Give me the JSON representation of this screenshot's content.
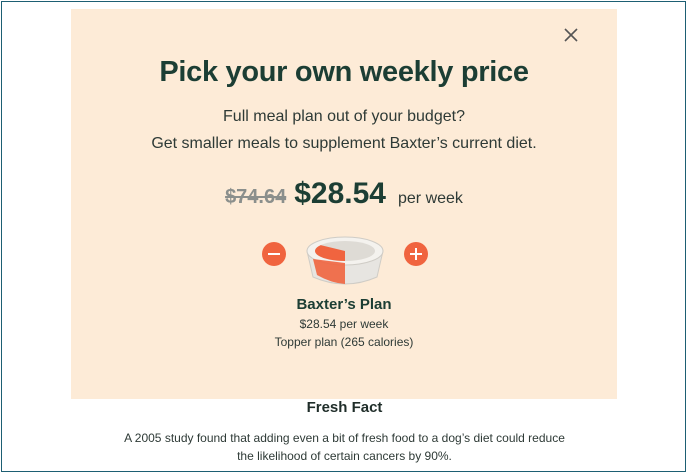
{
  "modal": {
    "title": "Pick your own weekly price",
    "subtitle_line1": "Full meal plan out of your budget?",
    "subtitle_line2": "Get smaller meals to supplement Baxter’s current diet.",
    "price": {
      "original": "$74.64",
      "current": "$28.54",
      "period": "per week"
    },
    "stepper": {
      "decrease_icon": "minus-circle-icon",
      "increase_icon": "plus-circle-icon",
      "bowl_fill_fraction": 0.35
    },
    "plan": {
      "name": "Baxter’s Plan",
      "price_line": "$28.54 per week",
      "type_line": "Topper plan (265 calories)"
    },
    "close_icon": "close-icon"
  },
  "fact": {
    "title": "Fresh Fact",
    "line1": "A 2005 study found that adding even a bit of fresh food to a dog’s diet could reduce",
    "line2": "the likelihood of certain cancers by 90%."
  },
  "colors": {
    "panel_bg": "#fdebd7",
    "accent": "#f0643f",
    "heading": "#1c3e34"
  }
}
